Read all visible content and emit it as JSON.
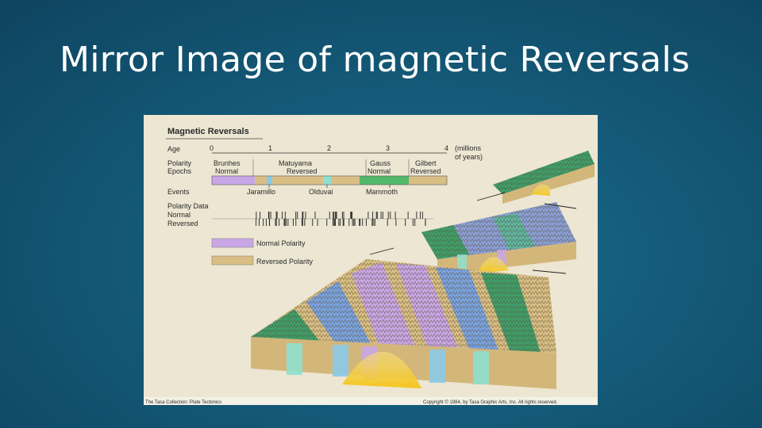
{
  "slide": {
    "title": "Mirror Image of magnetic Reversals"
  },
  "figure": {
    "heading": "Magnetic Reversals",
    "age_label": "Age",
    "ticks": [
      "0",
      "1",
      "2",
      "3",
      "4"
    ],
    "millions_line1": "(millions",
    "millions_line2": "of years)",
    "polarity_line1": "Polarity",
    "polarity_line2": "Epochs",
    "epochs": [
      {
        "name": "Brunhes",
        "sub": "Normal"
      },
      {
        "name": "Matuyama",
        "sub": "Reversed"
      },
      {
        "name": "Gauss",
        "sub": "Normal"
      },
      {
        "name": "Gilbert",
        "sub": "Reversed"
      }
    ],
    "events_label": "Events",
    "events": [
      "Jaramillo",
      "Olduvai",
      "Mammoth"
    ],
    "polarity_data_label": "Polarity Data",
    "normal_label": "Normal",
    "reversed_label": "Reversed",
    "legend": [
      {
        "label": "Normal Polarity",
        "color": "#c9a7e6"
      },
      {
        "label": "Reversed Polarity",
        "color": "#d9bf86"
      }
    ],
    "credit_left": "The Tasa Collection: Plate Tectonics",
    "credit_right": "Copyright © 1984, by Tasa Graphic Arts, Inc. All rights reserved.",
    "colors": {
      "normal": "#c9a7e6",
      "reversed": "#d9bf86",
      "green": "#52b86a",
      "blue": "#7aa3e0",
      "teal": "#8fe0cf",
      "magma": "#f2c21a"
    }
  }
}
